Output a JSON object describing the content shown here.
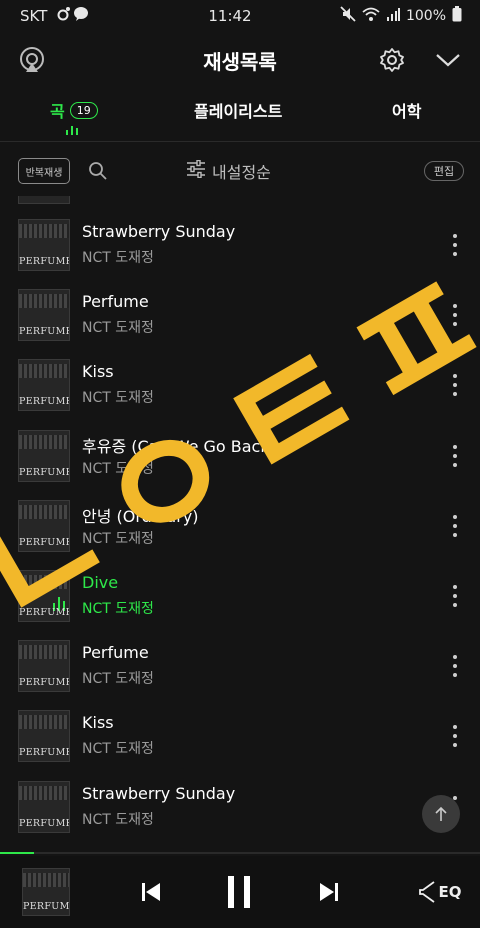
{
  "status_bar": {
    "carrier": "SKT",
    "time": "11:42",
    "battery": "100%"
  },
  "header": {
    "title": "재생목록"
  },
  "tabs": [
    {
      "label": "곡",
      "count": "19"
    },
    {
      "label": "플레이리스트"
    },
    {
      "label": "어학"
    }
  ],
  "toolbar": {
    "repeat_label": "반복재생",
    "sort_label": "내설정순",
    "edit_label": "편집"
  },
  "cover_text": "PERFUME",
  "songs": [
    {
      "title": "Strawberry Sunday",
      "artist": "NCT 도재정"
    },
    {
      "title": "Perfume",
      "artist": "NCT 도재정"
    },
    {
      "title": "Kiss",
      "artist": "NCT 도재정"
    },
    {
      "title": "후유증 (Can We Go Back)",
      "artist": "NCT 도재정"
    },
    {
      "title": "안녕 (Ordinary)",
      "artist": "NCT 도재정"
    },
    {
      "title": "Dive",
      "artist": "NCT 도재정",
      "playing": true
    },
    {
      "title": "Perfume",
      "artist": "NCT 도재정"
    },
    {
      "title": "Kiss",
      "artist": "NCT 도재정"
    },
    {
      "title": "Strawberry Sunday",
      "artist": "NCT 도재정"
    }
  ],
  "player": {
    "eq_label": "EQ",
    "progress": 0.07
  },
  "overlay_text": "ㄴㅇㅌㅍ",
  "colors": {
    "accent": "#2ee84a",
    "stamp": "#f2b82a"
  }
}
